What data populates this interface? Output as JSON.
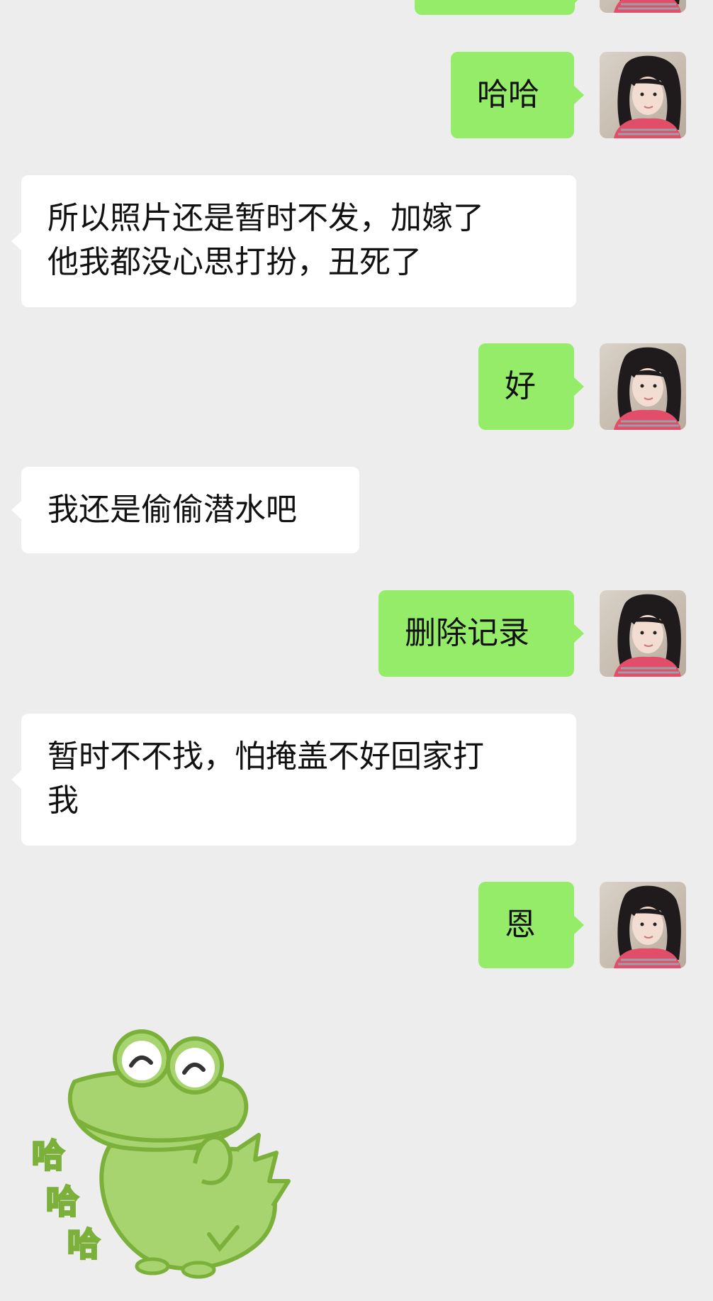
{
  "messages": [
    {
      "from": "me",
      "text": "哈哈"
    },
    {
      "from": "other",
      "text": "所以照片还是暂时不发，加嫁了\n他我都没心思打扮，丑死了"
    },
    {
      "from": "me",
      "text": "好"
    },
    {
      "from": "other",
      "text": "我还是偷偷潜水吧"
    },
    {
      "from": "me",
      "text": "删除记录"
    },
    {
      "from": "other",
      "text": "暂时不不找，怕掩盖不好回家打\n我"
    },
    {
      "from": "me",
      "text": "恩"
    }
  ],
  "sticker": {
    "text": "哈哈哈",
    "chars": [
      "哈",
      "哈",
      "哈"
    ],
    "icon": "green-frog-sticker"
  },
  "colors": {
    "background": "#ededed",
    "my_bubble": "#95ec69",
    "other_bubble": "#ffffff",
    "sticker_green": "#8cc63f"
  }
}
